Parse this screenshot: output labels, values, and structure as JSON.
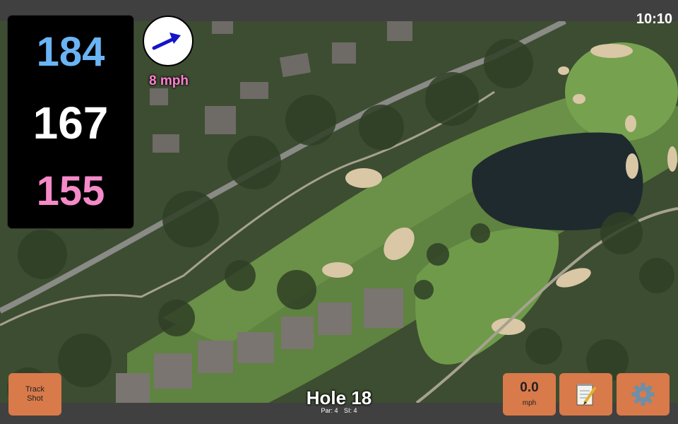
{
  "status_bar": {
    "time": "10:10"
  },
  "distances": {
    "back": "184",
    "middle": "167",
    "front": "155",
    "back_color": "#6ab4f5",
    "middle_color": "#ffffff",
    "front_color": "#f58ac9"
  },
  "wind": {
    "speed_label": "8 mph",
    "icon": "wind-direction-arrow",
    "arrow_color": "#1414c8"
  },
  "hole": {
    "title": "Hole 18",
    "par": "Par: 4",
    "si": "SI: 4"
  },
  "buttons": {
    "track_shot": [
      "Track",
      "Shot"
    ],
    "shot_distance_value": "0.0",
    "shot_distance_unit": "mph",
    "scorecard_icon": "notepad-icon",
    "settings_icon": "gear-icon",
    "color": "#d87a4a"
  },
  "map": {
    "type": "satellite-golf-course"
  }
}
